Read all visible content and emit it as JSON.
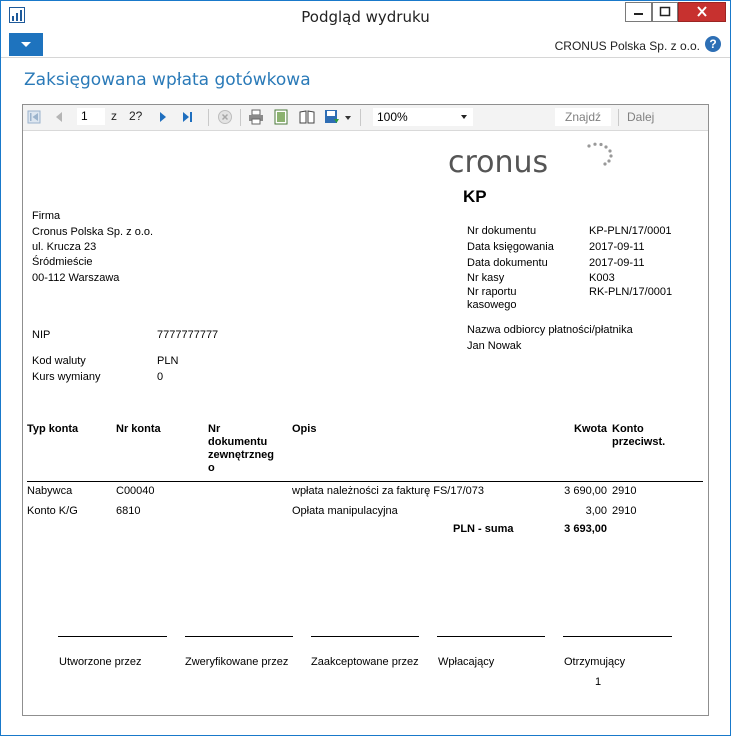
{
  "window": {
    "title": "Podgląd wydruku",
    "company": "CRONUS Polska Sp. z o.o.",
    "help_symbol": "?",
    "page_heading": "Zaksięgowana wpłata gotówkowa"
  },
  "toolbar": {
    "page_current": "1",
    "page_of_label": "z",
    "page_total": "2?",
    "zoom": "100%",
    "find_label": "Znajdź",
    "next_label": "Dalej",
    "icons": [
      "first-page-icon",
      "prev-page-icon",
      "next-page-icon",
      "last-page-icon",
      "stop-icon",
      "print-icon",
      "print-layout-icon",
      "page-setup-icon",
      "export-icon"
    ]
  },
  "report": {
    "logo_text": "cronus",
    "doc_code": "KP",
    "company_block": {
      "label": "Firma",
      "lines": [
        "Cronus Polska Sp. z o.o.",
        "ul. Krucza 23",
        "Śródmieście",
        "00-112 Warszawa"
      ]
    },
    "doc_fields": [
      {
        "label": "Nr dokumentu",
        "value": "KP-PLN/17/0001"
      },
      {
        "label": "Data księgowania",
        "value": "2017-09-11"
      },
      {
        "label": "Data dokumentu",
        "value": "2017-09-11"
      },
      {
        "label": "Nr kasy",
        "value": "K003"
      },
      {
        "label": "Nr raportu\nkasowego",
        "value": "RK-PLN/17/0001"
      }
    ],
    "payer_label": "Nazwa odbiorcy płatności/płatnika",
    "payer_name": "Jan Nowak",
    "nip_label": "NIP",
    "nip_value": "7777777777",
    "currency_label": "Kod waluty",
    "currency_value": "PLN",
    "rate_label": "Kurs wymiany",
    "rate_value": "0",
    "columns": {
      "typ_konta": "Typ konta",
      "nr_konta": "Nr konta",
      "nr_dok_zewn": "Nr\ndokumentu\nzewnętrzneg\no",
      "opis": "Opis",
      "kwota": "Kwota",
      "konto_przeciwst": "Konto\nprzeciwst."
    },
    "rows": [
      {
        "typ": "Nabywca",
        "nr": "C00040",
        "opis": "wpłata należności za fakturę FS/17/073",
        "kwota": "3 690,00",
        "konto": "2910"
      },
      {
        "typ": "Konto K/G",
        "nr": "6810",
        "opis": "Opłata manipulacyjna",
        "kwota": "3,00",
        "konto": "2910"
      }
    ],
    "total_label": "PLN - suma",
    "total_value": "3 693,00",
    "signatures": [
      "Utworzone przez",
      "Zweryfikowane przez",
      "Zaakceptowane przez",
      "Wpłacający",
      "Otrzymujący"
    ],
    "page_number": "1"
  }
}
